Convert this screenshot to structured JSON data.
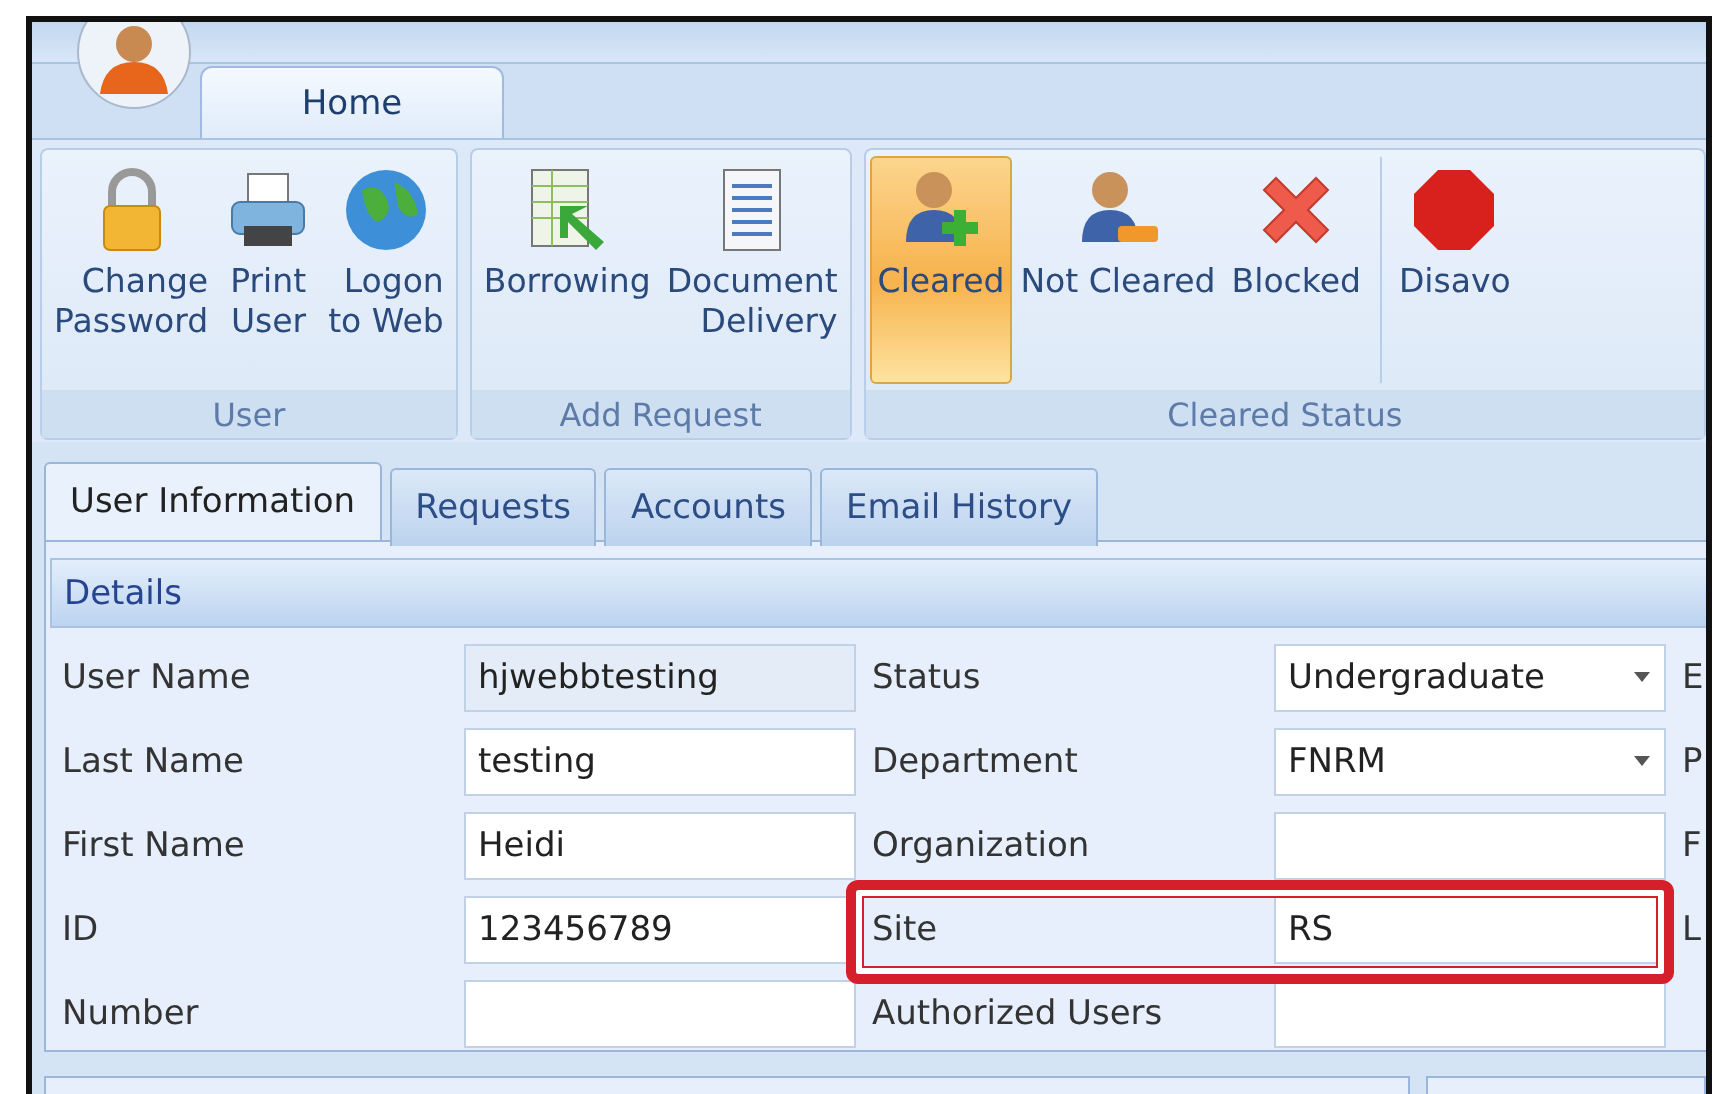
{
  "ribbon_tabs": [
    {
      "label": "Home",
      "selected": true
    }
  ],
  "ribbon_groups": [
    {
      "title": "User",
      "items": [
        {
          "label": "Change\nPassword",
          "kind": "lock",
          "selected": false
        },
        {
          "label": "Print\nUser",
          "kind": "printer",
          "selected": false
        },
        {
          "label": "Logon\nto Web",
          "kind": "globe",
          "selected": false
        }
      ]
    },
    {
      "title": "Add Request",
      "items": [
        {
          "label": "Borrowing",
          "kind": "sheet-arrow",
          "selected": false
        },
        {
          "label": "Document\nDelivery",
          "kind": "document",
          "selected": false
        }
      ]
    },
    {
      "title": "Cleared Status",
      "items": [
        {
          "label": "Cleared",
          "kind": "person-plus",
          "selected": true,
          "separated": false
        },
        {
          "label": "Not Cleared",
          "kind": "person-minus",
          "selected": false,
          "separated": false
        },
        {
          "label": "Blocked",
          "kind": "cross",
          "selected": false,
          "separated": false
        },
        {
          "label": "Disavo",
          "kind": "stop",
          "selected": false,
          "separated": true
        }
      ]
    }
  ],
  "tabs": [
    {
      "label": "User Information",
      "selected": true
    },
    {
      "label": "Requests",
      "selected": false
    },
    {
      "label": "Accounts",
      "selected": false
    },
    {
      "label": "Email History",
      "selected": false
    }
  ],
  "details": {
    "title": "Details",
    "rows": [
      {
        "label": "User Name",
        "field": {
          "value": "hjwebbtesting",
          "readonly": true
        },
        "label_2": "Status",
        "field_2": {
          "kind": "dropdown",
          "value": "Undergraduate"
        },
        "label_3": "E"
      },
      {
        "label": "Last Name",
        "field": {
          "value": "testing"
        },
        "label_2": "Department",
        "field_2": {
          "kind": "dropdown",
          "value": "FNRM"
        },
        "label_3": "P"
      },
      {
        "label": "First Name",
        "field": {
          "value": "Heidi"
        },
        "label_2": "Organization",
        "field_2": {
          "kind": "text"
        },
        "label_3": "F"
      },
      {
        "label": "ID",
        "field": {
          "value": "123456789"
        },
        "label_2": "Site",
        "field_2": {
          "kind": "text",
          "value": "RS"
        },
        "label_3": "L",
        "highlighted": true
      },
      {
        "label": "Number",
        "field": {},
        "label_2": "Authorized Users",
        "field_2": {
          "kind": "text"
        }
      }
    ]
  }
}
